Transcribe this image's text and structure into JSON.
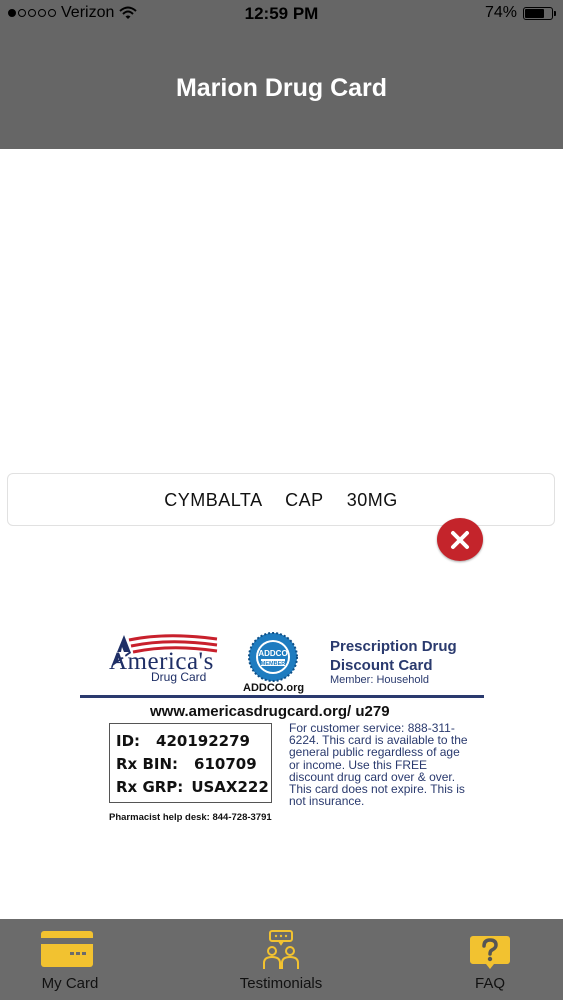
{
  "status_bar": {
    "carrier": "Verizon",
    "signal_filled_dots": 1,
    "signal_total_dots": 5,
    "time": "12:59 PM",
    "battery_percent": "74%",
    "battery_level": 0.74
  },
  "header": {
    "title": "Marion Drug Card"
  },
  "drug": {
    "name": "CYMBALTA CAP 30MG"
  },
  "card": {
    "brand_line1": "America's",
    "brand_line2": "Drug Card",
    "seal_label": "ADDCO.org",
    "seal_text_top": "ADDCO",
    "seal_text_bottom": "MEMBER",
    "title_line1": "Prescription Drug",
    "title_line2": "Discount Card",
    "member": "Member: Household",
    "website": "www.americasdrugcard.org/ u279",
    "id_label": "ID:",
    "id_value": "420192279",
    "bin_label": "Rx BIN:",
    "bin_value": "610709",
    "grp_label": "Rx GRP:",
    "grp_value": "USAX222",
    "pharmacist_help": "Pharmacist help desk: 844-728-3791",
    "service_text": "For customer service: 888-311-6224. This card is available to the general public regardless of age or income. Use this FREE discount drug card over & over. This card does not expire. This is not insurance."
  },
  "colors": {
    "header_bg": "#666666",
    "tab_bar_bg": "#6b6b6b",
    "accent_yellow": "#f2c230",
    "close_red": "#c4242b",
    "card_navy": "#2a3a6e"
  },
  "tabs": [
    {
      "label": "My Card",
      "icon": "credit-card-icon"
    },
    {
      "label": "Testimonials",
      "icon": "people-chat-icon"
    },
    {
      "label": "FAQ",
      "icon": "question-bubble-icon"
    }
  ]
}
